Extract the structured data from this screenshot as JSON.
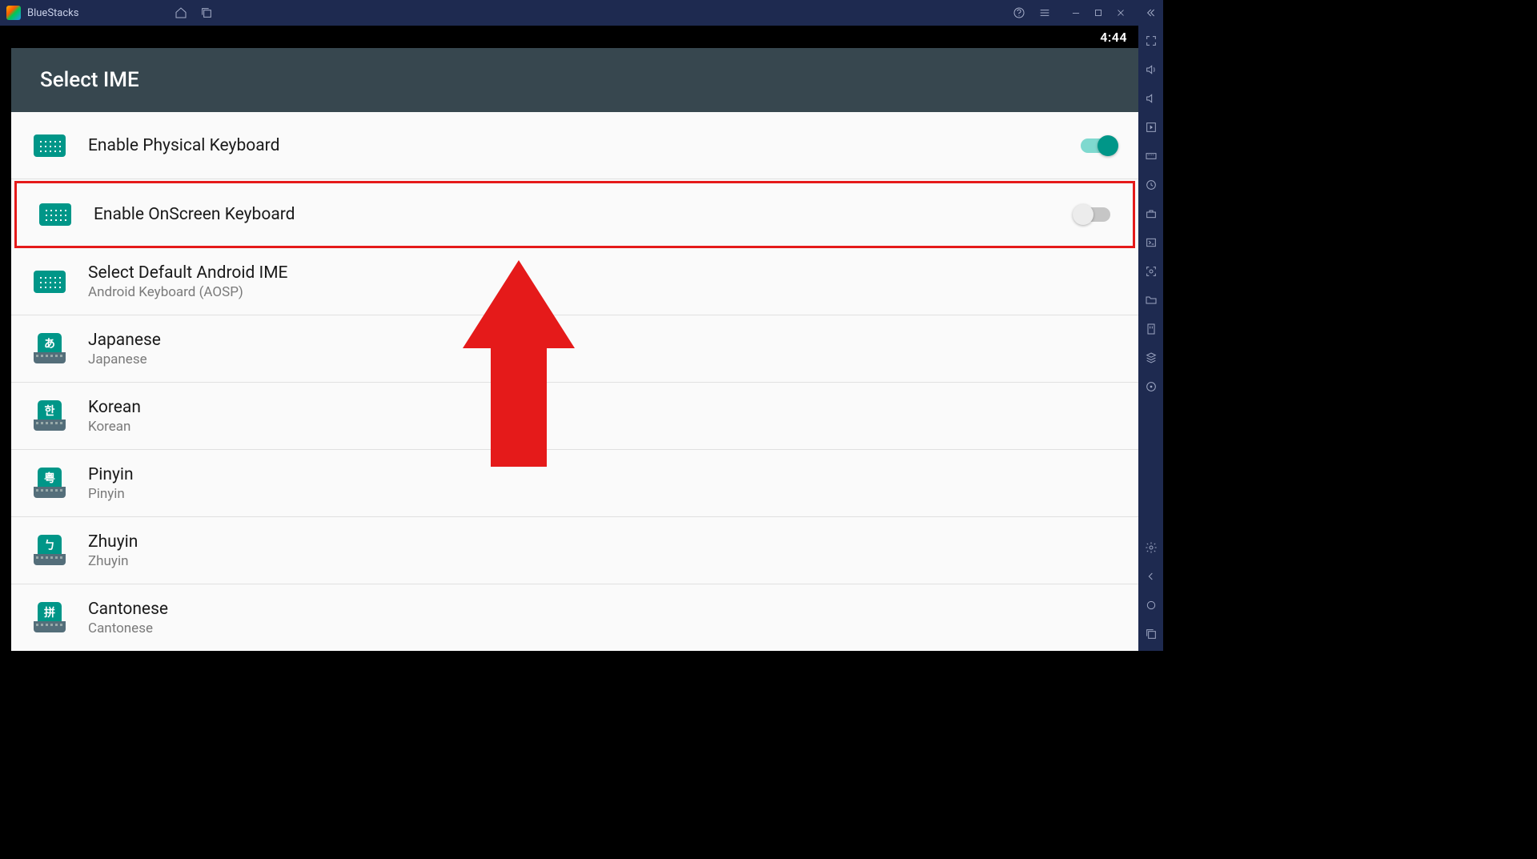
{
  "app": {
    "name": "BlueStacks"
  },
  "status": {
    "time": "4:44"
  },
  "page": {
    "title": "Select IME"
  },
  "settings": {
    "rows": [
      {
        "title": "Enable Physical Keyboard",
        "sub": "",
        "toggle": "on",
        "icon": "kb",
        "highlighted": false
      },
      {
        "title": "Enable OnScreen Keyboard",
        "sub": "",
        "toggle": "off",
        "icon": "kb",
        "highlighted": true
      },
      {
        "title": "Select Default Android IME",
        "sub": "Android Keyboard (AOSP)",
        "toggle": "",
        "icon": "kb",
        "highlighted": false
      },
      {
        "title": "Japanese",
        "sub": "Japanese",
        "toggle": "",
        "icon": "lang",
        "badge": "あ",
        "highlighted": false
      },
      {
        "title": "Korean",
        "sub": "Korean",
        "toggle": "",
        "icon": "lang",
        "badge": "한",
        "highlighted": false
      },
      {
        "title": "Pinyin",
        "sub": "Pinyin",
        "toggle": "",
        "icon": "lang",
        "badge": "粤",
        "highlighted": false
      },
      {
        "title": "Zhuyin",
        "sub": "Zhuyin",
        "toggle": "",
        "icon": "lang",
        "badge": "ㄅ",
        "highlighted": false
      },
      {
        "title": "Cantonese",
        "sub": "Cantonese",
        "toggle": "",
        "icon": "lang",
        "badge": "拼",
        "highlighted": false
      }
    ]
  }
}
